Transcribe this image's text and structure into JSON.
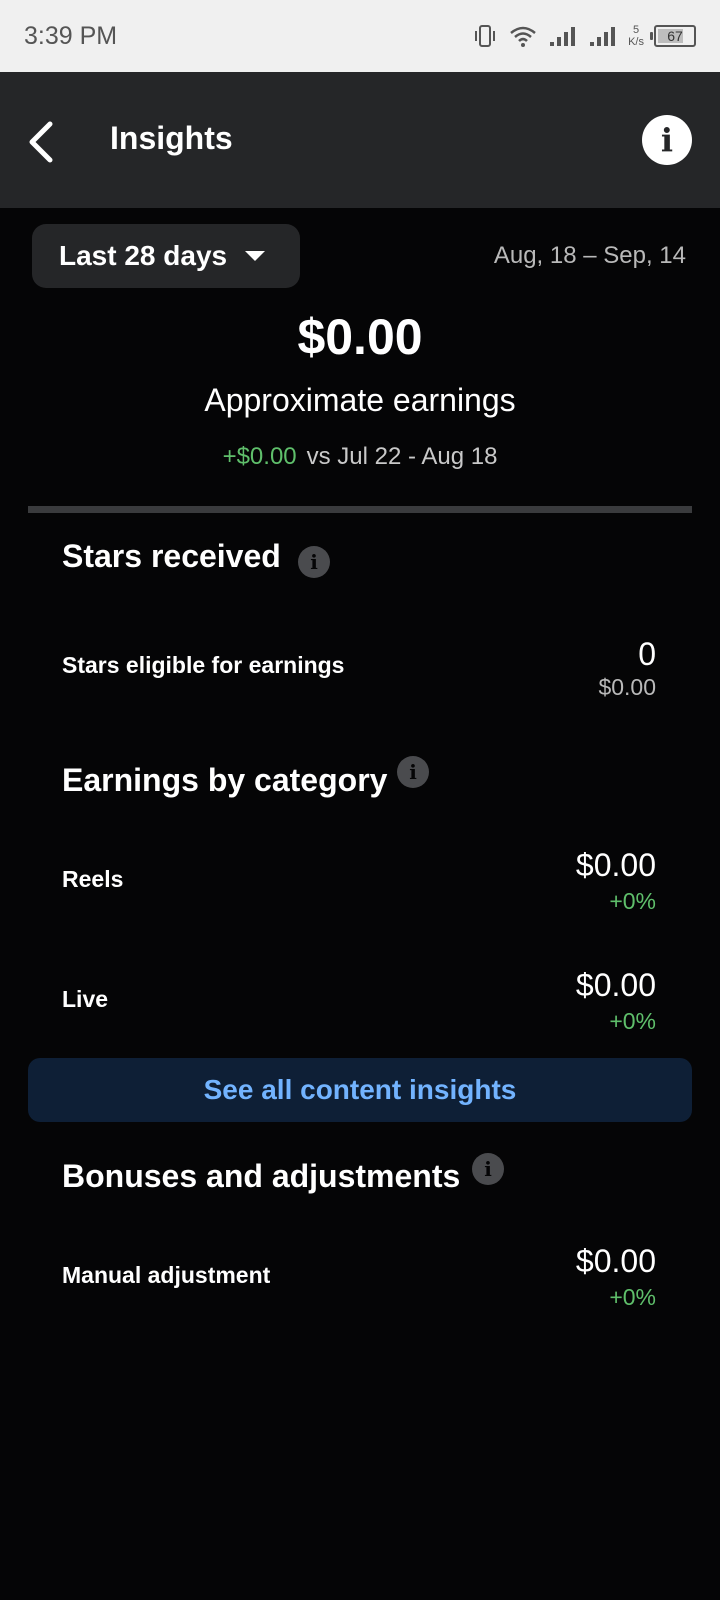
{
  "status": {
    "time": "3:39 PM",
    "net_speed_value": "5",
    "net_speed_unit": "K/s",
    "battery": "67"
  },
  "header": {
    "title": "Insights"
  },
  "range": {
    "label": "Last 28 days",
    "dates": "Aug, 18 – Sep, 14"
  },
  "summary": {
    "total": "$0.00",
    "label": "Approximate earnings",
    "change": "+$0.00",
    "compare": "vs Jul 22 - Aug 18"
  },
  "stars": {
    "title": "Stars received",
    "row_label": "Stars eligible for earnings",
    "row_value": "0",
    "row_sub": "$0.00"
  },
  "category": {
    "title": "Earnings by category",
    "rows": [
      {
        "label": "Reels",
        "value": "$0.00",
        "change": "+0%"
      },
      {
        "label": "Live",
        "value": "$0.00",
        "change": "+0%"
      }
    ]
  },
  "cta": {
    "label": "See all content insights"
  },
  "bonuses": {
    "title": "Bonuses and adjustments",
    "row_label": "Manual adjustment",
    "row_value": "$0.00",
    "row_change": "+0%"
  },
  "colors": {
    "positive": "#5fbf6b",
    "link": "#72b3ff",
    "header_bg": "#252628"
  }
}
